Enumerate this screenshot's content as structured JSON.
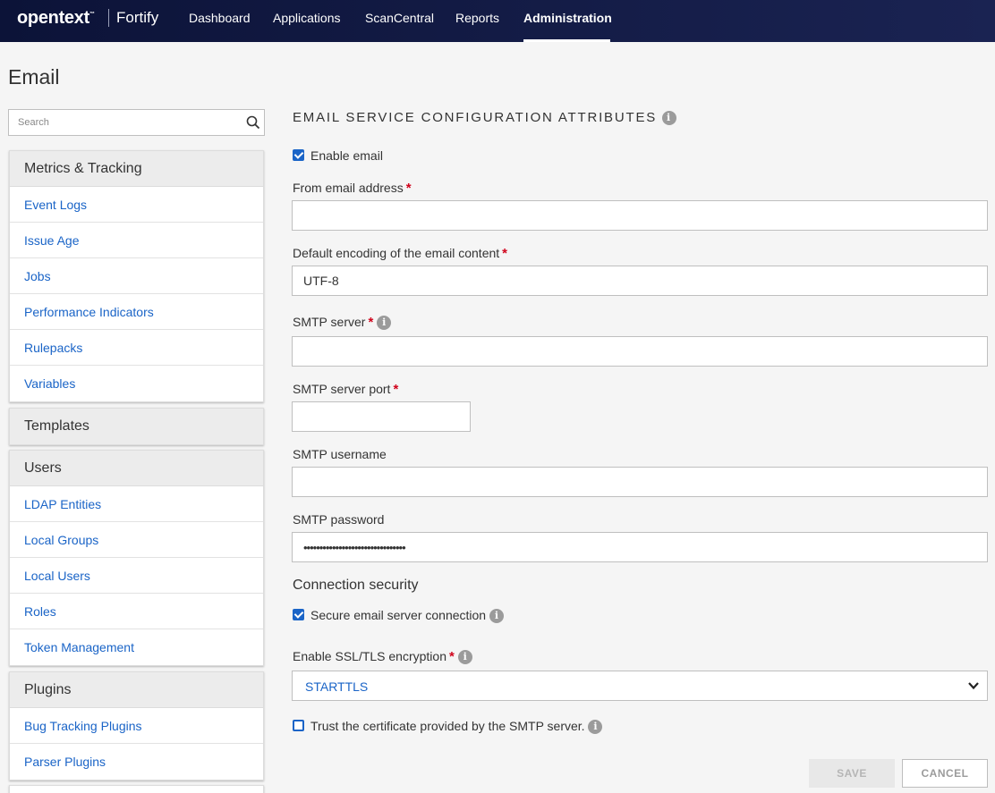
{
  "header": {
    "brand": "opentext",
    "brand_tm": "™",
    "product": "Fortify",
    "nav": [
      "Dashboard",
      "Applications",
      "ScanCentral",
      "Reports",
      "Administration"
    ]
  },
  "page_title": "Email",
  "sidebar": {
    "search_placeholder": "Search",
    "groups": [
      {
        "title": "Metrics & Tracking",
        "items": [
          "Event Logs",
          "Issue Age",
          "Jobs",
          "Performance Indicators",
          "Rulepacks",
          "Variables"
        ]
      },
      {
        "title": "Templates",
        "items": []
      },
      {
        "title": "Users",
        "items": [
          "LDAP Entities",
          "Local Groups",
          "Local Users",
          "Roles",
          "Token Management"
        ]
      },
      {
        "title": "Plugins",
        "items": [
          "Bug Tracking Plugins",
          "Parser Plugins"
        ]
      }
    ]
  },
  "form": {
    "section_title": "EMAIL SERVICE CONFIGURATION ATTRIBUTES",
    "enable_email_label": "Enable email",
    "enable_email_checked": true,
    "from_label": "From email address",
    "from_value": "",
    "encoding_label": "Default encoding of the email content",
    "encoding_value": "UTF-8",
    "smtp_server_label": "SMTP server",
    "smtp_server_value": "",
    "smtp_port_label": "SMTP server port",
    "smtp_port_value": "",
    "smtp_user_label": "SMTP username",
    "smtp_user_value": "",
    "smtp_password_label": "SMTP password",
    "smtp_password_value": "••••••••••••••••••••••••••••••••",
    "connection_security_label": "Connection security",
    "secure_conn_label": "Secure email server connection",
    "secure_conn_checked": true,
    "ssl_label": "Enable SSL/TLS encryption",
    "ssl_value": "STARTTLS",
    "trust_label": "Trust the certificate provided by the SMTP server.",
    "trust_checked": false,
    "required_mark": "*",
    "info_glyph": "i"
  },
  "buttons": {
    "save": "SAVE",
    "cancel": "CANCEL"
  },
  "colors": {
    "nav_bg": "#0c1338",
    "link": "#1a64c7",
    "required": "#d0021b"
  }
}
